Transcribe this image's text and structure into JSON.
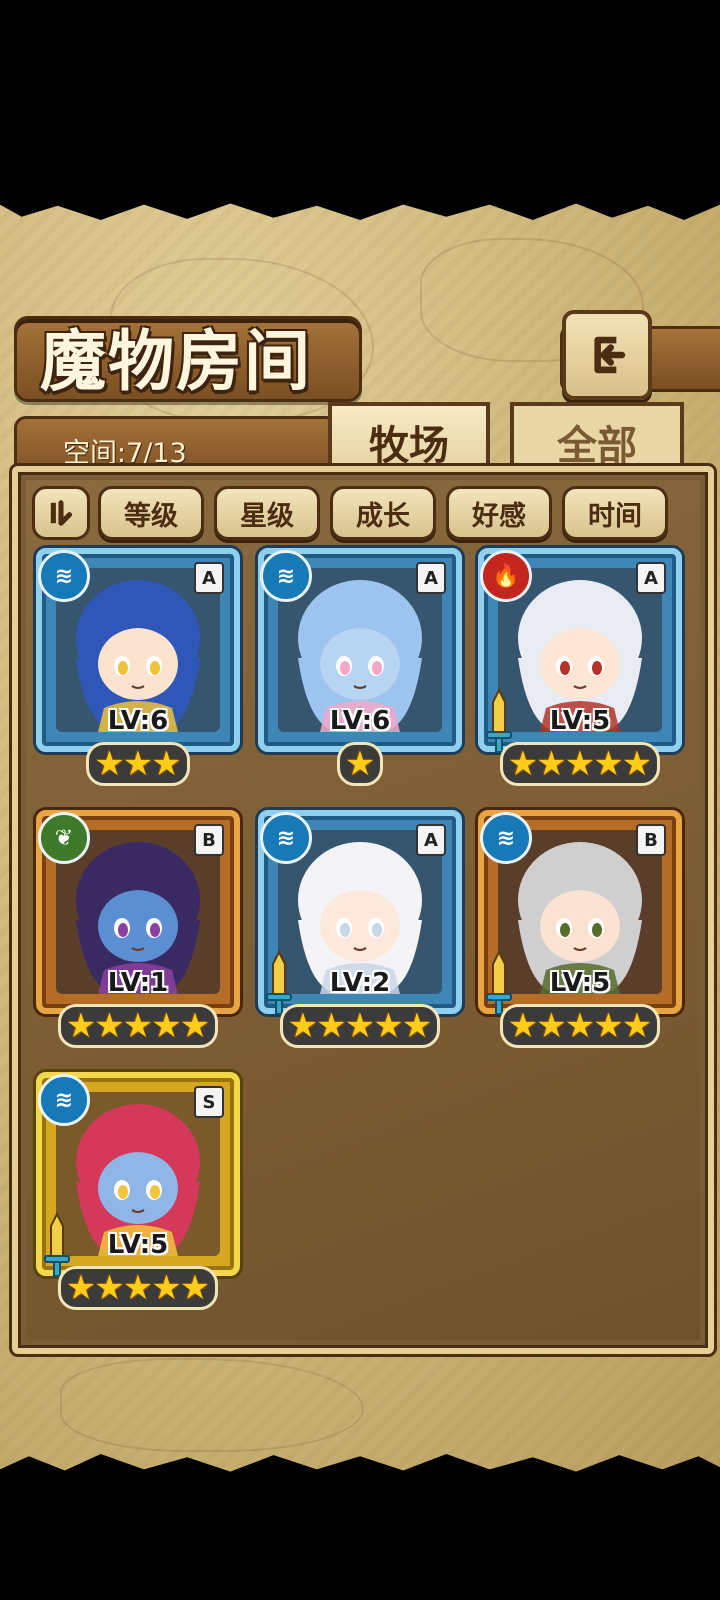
{
  "header": {
    "title": "魔物房间",
    "back_icon": "return-arrow-icon"
  },
  "capacity": {
    "label": "空间:7/13"
  },
  "tabs": [
    {
      "label": "牧场",
      "active": true
    },
    {
      "label": "全部",
      "active": false
    }
  ],
  "sort_buttons": [
    {
      "label": "等级"
    },
    {
      "label": "星级"
    },
    {
      "label": "成长"
    },
    {
      "label": "好感"
    },
    {
      "label": "时间"
    }
  ],
  "monsters": [
    {
      "level": "LV:6",
      "stars": 3,
      "rank": "A",
      "element": "water",
      "frame": "A",
      "has_sword": false,
      "hair": "#2f57b8",
      "skin": "#fbe3d0",
      "accent": "#f0c23a"
    },
    {
      "level": "LV:6",
      "stars": 1,
      "rank": "A",
      "element": "water",
      "frame": "A",
      "has_sword": false,
      "hair": "#9cc4ee",
      "skin": "#b7d4f3",
      "accent": "#f2a8c8"
    },
    {
      "level": "LV:5",
      "stars": 5,
      "rank": "A",
      "element": "fire",
      "frame": "A",
      "has_sword": true,
      "hair": "#e9edf3",
      "skin": "#fde6d6",
      "accent": "#b3342a"
    },
    {
      "level": "LV:1",
      "stars": 5,
      "rank": "B",
      "element": "wood",
      "frame": "B",
      "has_sword": false,
      "hair": "#3a2a63",
      "skin": "#5c8fd2",
      "accent": "#8c3fa0"
    },
    {
      "level": "LV:2",
      "stars": 5,
      "rank": "A",
      "element": "water",
      "frame": "A",
      "has_sword": true,
      "hair": "#f4f4f6",
      "skin": "#fde9dc",
      "accent": "#c9d6e6"
    },
    {
      "level": "LV:5",
      "stars": 5,
      "rank": "B",
      "element": "water",
      "frame": "B",
      "has_sword": true,
      "hair": "#cfcfcf",
      "skin": "#fbe2d2",
      "accent": "#586b2e"
    },
    {
      "level": "LV:5",
      "stars": 5,
      "rank": "S",
      "element": "water",
      "frame": "S",
      "has_sword": true,
      "hair": "#d4385a",
      "skin": "#8fb6e6",
      "accent": "#f2c43a"
    }
  ],
  "element_icons": {
    "water": "water-wave-icon",
    "fire": "fire-icon",
    "wood": "leaf-icon"
  }
}
